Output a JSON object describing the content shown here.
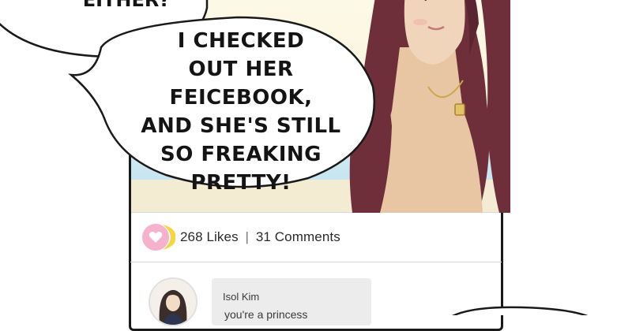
{
  "speech_bubble_top": {
    "text": "EITHER?"
  },
  "speech_bubble_main": {
    "lines": [
      "I CHECKED",
      "OUT HER FEICEBOOK,",
      "AND SHE'S STILL",
      "SO FREAKING",
      "PRETTY!"
    ]
  },
  "post": {
    "likes": "268 Likes",
    "separator": "|",
    "comments": "31 Comments"
  },
  "comment": {
    "author": "Isol Kim",
    "text": "you're a princess"
  },
  "colors": {
    "heart_badge": "#f6b1cc",
    "moon_badge": "#f5d640",
    "hair": "#6e2f3a",
    "comment_bg": "#ececec"
  }
}
